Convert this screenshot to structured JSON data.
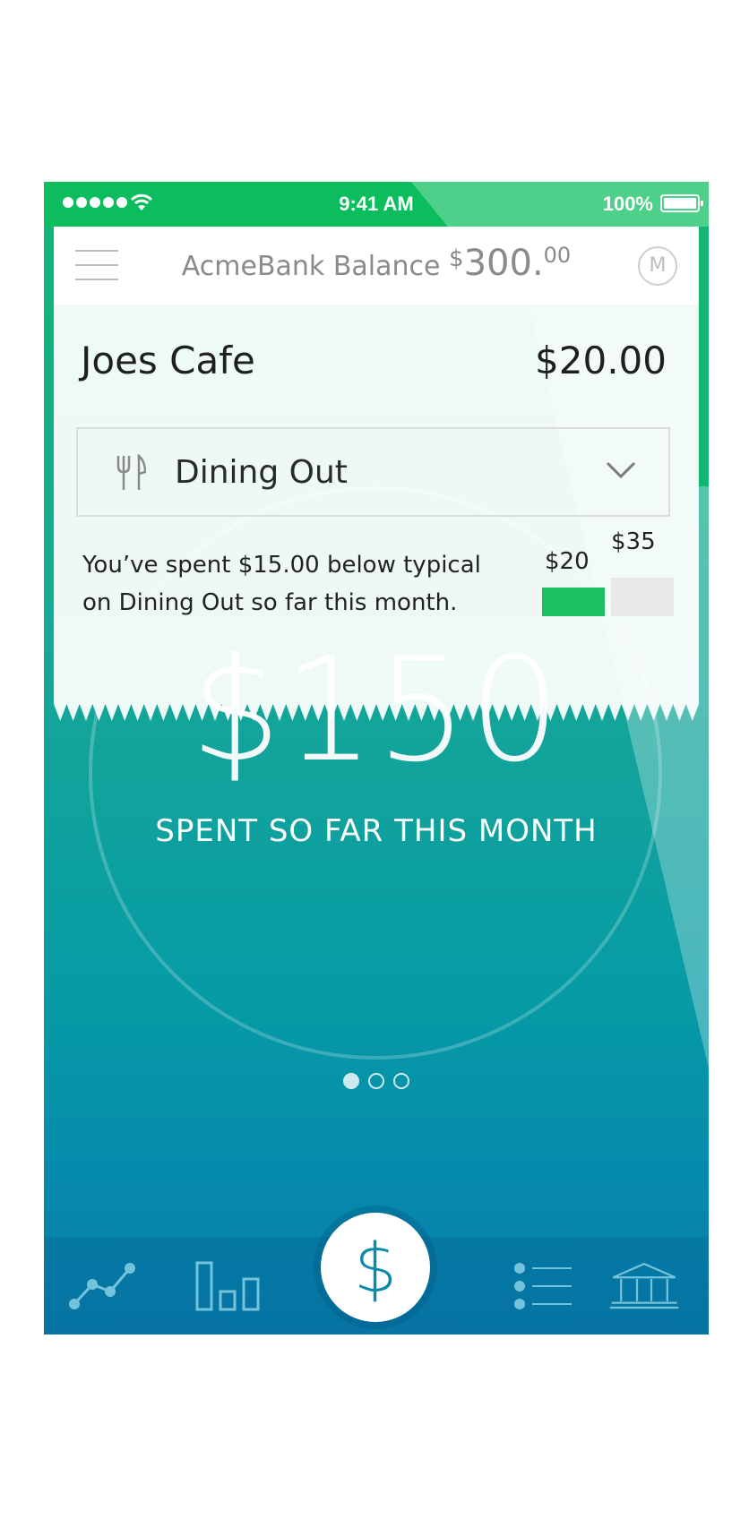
{
  "status_bar": {
    "time": "9:41 AM",
    "battery_percent": "100%"
  },
  "header": {
    "bank_label": "AcmeBank Balance",
    "balance_currency": "$",
    "balance_main": "300.",
    "balance_cents": "00",
    "avatar_initial": "M"
  },
  "transaction": {
    "merchant": "Joes Cafe",
    "amount": "$20.00",
    "category": "Dining Out",
    "insight_line1": "You’ve spent $15.00 below typical",
    "insight_line2": "on Dining Out so far this month.",
    "comparison": {
      "actual_label": "$20",
      "typical_label": "$35",
      "actual_value": 20,
      "typical_value": 35
    }
  },
  "summary": {
    "spent_amount": "$150",
    "spent_label": "SPENT SO FAR THIS MONTH"
  },
  "pager": {
    "page_count": 3,
    "active_page": 1
  },
  "tabbar": {
    "tabs": [
      "trend-icon",
      "bar-chart-icon",
      "dollar-icon",
      "list-icon",
      "bank-icon"
    ],
    "fab_symbol": "$"
  },
  "colors": {
    "brand_green": "#0bbd5c",
    "accent_green": "#1dbf63",
    "teal": "#069aa6",
    "fab_blue": "#0c8aa9"
  }
}
